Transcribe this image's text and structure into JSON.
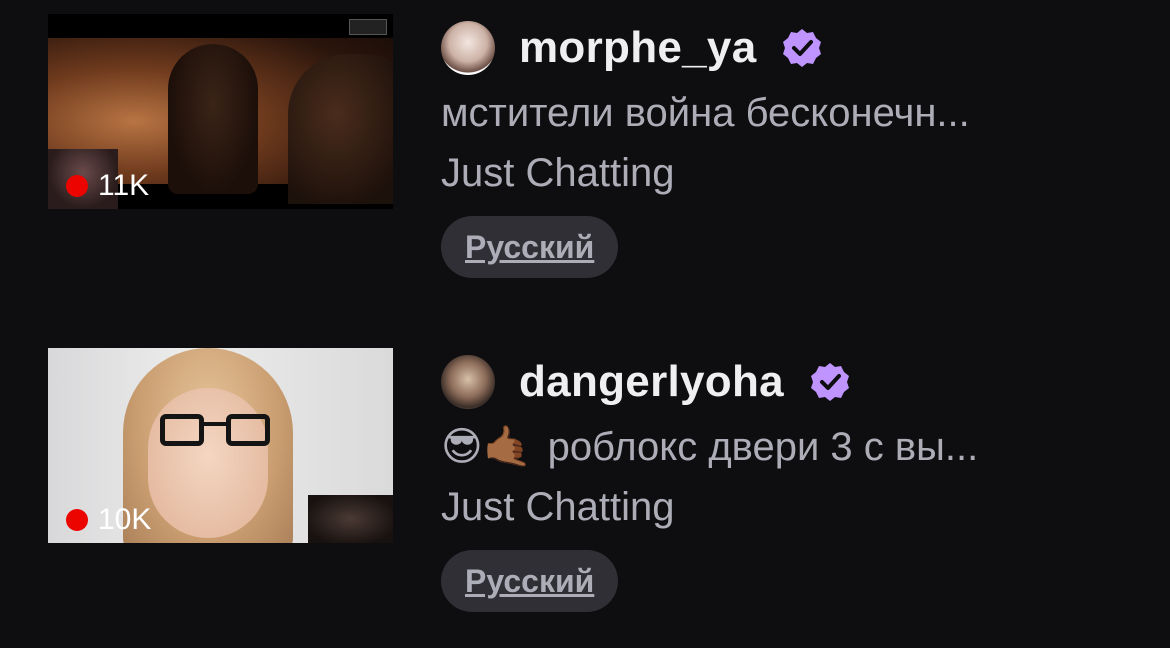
{
  "colors": {
    "background": "#0e0e10",
    "live_red": "#eb0400",
    "verified_purple": "#bf94ff",
    "text_primary": "#efeff1",
    "text_secondary": "#adadb8",
    "tag_bg": "#2f2f35"
  },
  "streams": [
    {
      "viewers": "11K",
      "channel": "morphe_ya",
      "verified": true,
      "title": "мстители война бесконечн...",
      "title_emoji": "",
      "category": "Just Chatting",
      "tag": "Русский"
    },
    {
      "viewers": "10K",
      "channel": "dangerlyoha",
      "verified": true,
      "title": "роблокс двери 3 с вы...",
      "title_emoji": "😎🤙🏾",
      "category": "Just Chatting",
      "tag": "Русский"
    }
  ]
}
